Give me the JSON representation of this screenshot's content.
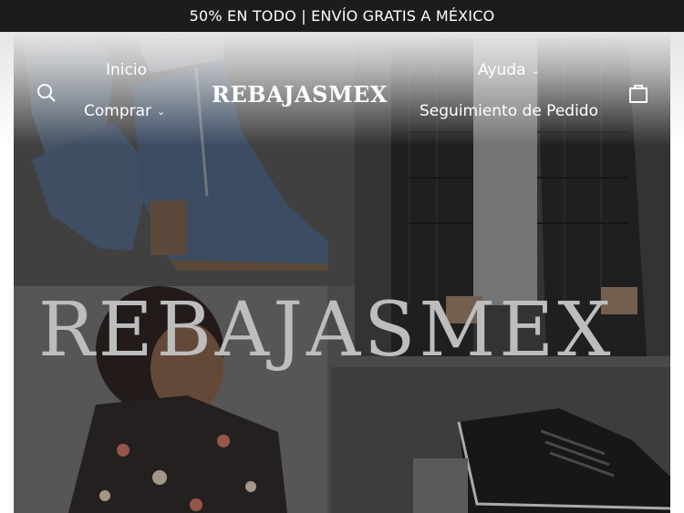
{
  "announcement": {
    "text": "50% EN TODO | ENVÍO GRATIS A MÉXICO"
  },
  "header": {
    "logo": "REBAJASMEX",
    "nav_left": [
      {
        "label": "Inicio"
      },
      {
        "label": "Comprar",
        "has_dropdown": true
      }
    ],
    "nav_right": [
      {
        "label": "Ayuda",
        "has_dropdown": true
      },
      {
        "label": "Seguimiento de Pedido"
      }
    ],
    "icons": {
      "search": "search-icon",
      "cart": "bag-icon"
    }
  },
  "hero": {
    "watermark_text": "REBAJASMEX",
    "images": [
      "blue-ankle-boots-image",
      "black-puffer-jacket-image",
      "woman-floral-top-image",
      "black-dress-shoes-image"
    ]
  },
  "colors": {
    "announcement_bg": "#1c1c1c",
    "text_light": "#ffffff"
  }
}
